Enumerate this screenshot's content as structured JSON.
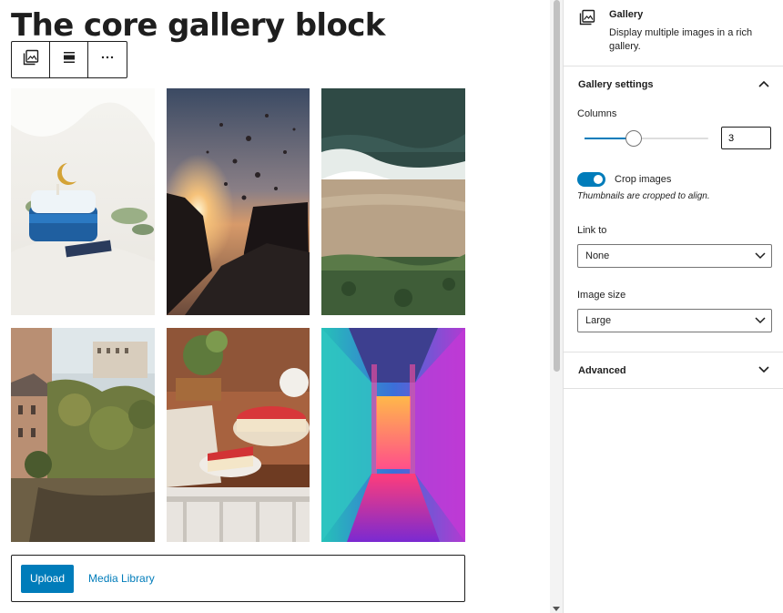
{
  "editor": {
    "title": "The core gallery block",
    "toolbar": {
      "buttons": [
        "gallery-icon",
        "align-icon",
        "more-options-icon"
      ],
      "more_label": "⋮"
    },
    "gallery": {
      "columns": 3,
      "images": [
        "birthday-cake-with-moon",
        "sunset-splash-rocks",
        "aerial-beach-waves",
        "european-town-river",
        "strawberry-cheesecake",
        "neon-corridor"
      ]
    },
    "upload_label": "Upload",
    "media_label": "Media Library"
  },
  "sidebar": {
    "block": {
      "name": "Gallery",
      "description": "Display multiple images in a rich gallery.",
      "icon": "gallery-icon"
    },
    "settings_panel": {
      "title": "Gallery settings",
      "columns_label": "Columns",
      "columns_value": "3",
      "columns_fraction": 0.4,
      "crop_label": "Crop images",
      "crop_on": true,
      "crop_help": "Thumbnails are cropped to align.",
      "link_label": "Link to",
      "link_value": "None",
      "size_label": "Image size",
      "size_value": "Large"
    },
    "advanced_title": "Advanced"
  },
  "colors": {
    "accent": "#007cba",
    "text": "#1e1e1e",
    "border": "#e0e0e0"
  }
}
